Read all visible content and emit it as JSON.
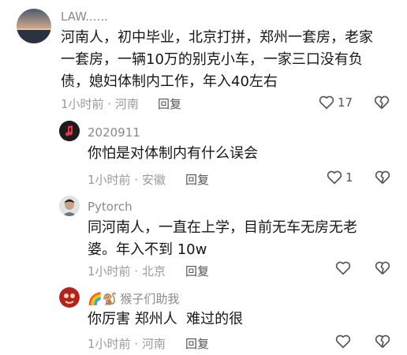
{
  "comments": [
    {
      "username": "LAW......",
      "lines": [
        "河南人，初中毕业，北京打拼，郑州一套房，老家",
        "一套房，一辆10万的别克小车，一家三口没有负",
        "债，媳妇体制内工作，年入40左右"
      ],
      "time_location": "1小时前 · 河南",
      "reply_label": "回复",
      "like_count": "17",
      "avatar_icon": "lake-sunset-avatar-icon"
    },
    {
      "username": "2020911",
      "lines": [
        "你怕是对体制内有什么误会"
      ],
      "time_location": "1小时前 · 安徽",
      "reply_label": "回复",
      "like_count": "1",
      "avatar_icon": "music-note-avatar-icon"
    },
    {
      "username": "Pytorch",
      "lines": [
        "同河南人，一直在上学，目前无车无房无老",
        "婆。年入不到 10w"
      ],
      "time_location": "1小时前 · 北京",
      "reply_label": "回复",
      "like_count": "",
      "avatar_icon": "person-avatar-icon"
    },
    {
      "username_emoji": "🌈🐒",
      "username": "猴子们助我",
      "lines": [
        "你厉害 郑州人  难过的很"
      ],
      "time_location": "1小时前 · 河南",
      "reply_label": "回复",
      "like_count": "",
      "avatar_icon": "red-character-avatar-icon"
    }
  ]
}
